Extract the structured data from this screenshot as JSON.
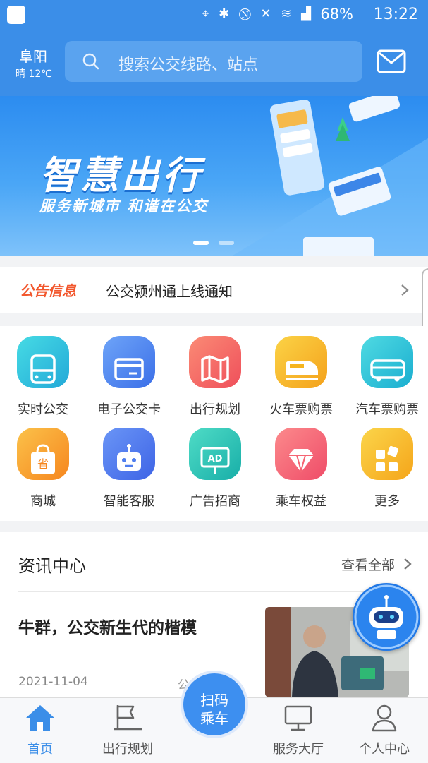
{
  "status_bar": {
    "battery": "68%",
    "time": "13:22"
  },
  "header": {
    "city": "阜阳",
    "weather": "晴 12℃",
    "search_placeholder": "搜索公交线路、站点"
  },
  "banner": {
    "title": "智慧出行",
    "subtitle": "服务新城市 和谐在公交",
    "page_count": 2,
    "active_page": 1
  },
  "notice": {
    "tag": "公告信息",
    "text": "公交颍州通上线通知"
  },
  "services": [
    {
      "label": "实时公交",
      "icon": "bus-icon",
      "color": "#2fc3dc"
    },
    {
      "label": "电子公交卡",
      "icon": "card-icon",
      "color": "#4f86ef"
    },
    {
      "label": "出行规划",
      "icon": "map-icon",
      "color": "#f2685f"
    },
    {
      "label": "火车票购票",
      "icon": "train-icon",
      "color": "#f6b51f"
    },
    {
      "label": "汽车票购票",
      "icon": "coach-icon",
      "color": "#24c4d3"
    },
    {
      "label": "商城",
      "icon": "shopping-bag-icon",
      "color": "#f8a12a"
    },
    {
      "label": "智能客服",
      "icon": "robot-icon",
      "color": "#4f7eef"
    },
    {
      "label": "广告招商",
      "icon": "ad-board-icon",
      "color": "#28c2b5"
    },
    {
      "label": "乘车权益",
      "icon": "diamond-icon",
      "color": "#f56473"
    },
    {
      "label": "更多",
      "icon": "grid-icon",
      "color": "#f6b51f"
    }
  ],
  "news": {
    "title": "资讯中心",
    "view_all": "查看全部",
    "articles": [
      {
        "title": "牛群，公交新生代的楷模",
        "date": "2021-11-04",
        "source": "公...通"
      }
    ]
  },
  "tabbar": {
    "items": [
      {
        "label": "首页",
        "icon": "home-icon",
        "active": true
      },
      {
        "label": "出行规划",
        "icon": "flag-icon",
        "active": false
      },
      {
        "label": "服务大厅",
        "icon": "monitor-icon",
        "active": false
      },
      {
        "label": "个人中心",
        "icon": "user-icon",
        "active": false
      }
    ],
    "scan_line1": "扫码",
    "scan_line2": "乘车"
  },
  "colors": {
    "primary": "#3b8ee8",
    "accent_orange": "#f2572d"
  }
}
